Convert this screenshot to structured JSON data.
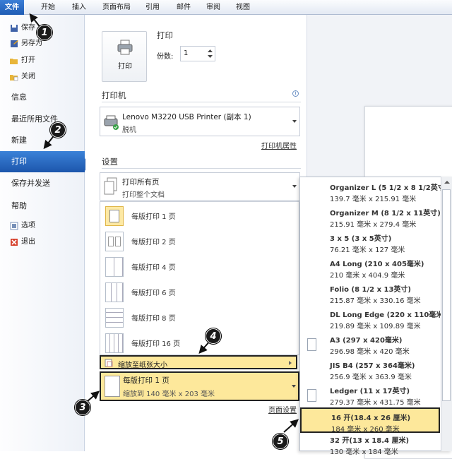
{
  "ribbon": {
    "tabs": [
      "文件",
      "开始",
      "插入",
      "页面布局",
      "引用",
      "邮件",
      "审阅",
      "视图"
    ]
  },
  "sidebar": {
    "save": "保存",
    "save_as": "另存为",
    "open": "打开",
    "close": "关闭",
    "info": "信息",
    "recent": "最近所用文件",
    "new": "新建",
    "print": "打印",
    "save_send": "保存并发送",
    "help": "帮助",
    "options": "选项",
    "exit": "退出"
  },
  "print": {
    "title": "打印",
    "button_label": "打印",
    "copies_label": "份数:",
    "copies_value": "1"
  },
  "printer": {
    "header": "打印机",
    "name": "Lenovo M3220 USB Printer (副本 1)",
    "status": "脱机",
    "properties_link": "打印机属性"
  },
  "settings": {
    "header": "设置",
    "range_title": "打印所有页",
    "range_sub": "打印整个文档",
    "page_setup_link": "页面设置"
  },
  "pages_per_sheet": {
    "options": [
      "每版打印 1 页",
      "每版打印 2 页",
      "每版打印 4 页",
      "每版打印 6 页",
      "每版打印 8 页",
      "每版打印 16 页"
    ],
    "scale_label": "缩放至纸张大小",
    "current_title": "每版打印 1 页",
    "current_sub": "缩放到 140 毫米 x 203 毫米"
  },
  "paper_sizes": [
    {
      "name": "Organizer L (5 1/2 x 8 1/2英寸)",
      "dims": "139.7 毫米 x 215.91 毫米"
    },
    {
      "name": "Organizer M (8 1/2 x 11英寸)",
      "dims": "215.91 毫米 x 279.4 毫米"
    },
    {
      "name": "3 x 5 (3 x 5英寸)",
      "dims": "76.21 毫米 x 127 毫米"
    },
    {
      "name": "A4 Long (210 x 405毫米)",
      "dims": "210 毫米 x 404.9 毫米"
    },
    {
      "name": "Folio (8 1/2 x 13英寸)",
      "dims": "215.87 毫米 x 330.16 毫米"
    },
    {
      "name": "DL Long Edge (220 x 110毫米)",
      "dims": "219.89 毫米 x 109.89 毫米"
    },
    {
      "name": "A3 (297 x 420毫米)",
      "dims": "296.98 毫米 x 420 毫米"
    },
    {
      "name": "JIS B4 (257 x 364毫米)",
      "dims": "256.9 毫米 x 363.9 毫米"
    },
    {
      "name": "Ledger (11 x 17英寸)",
      "dims": "279.37 毫米 x 431.75 毫米"
    },
    {
      "name": "16 开(18.4 x 26 厘米)",
      "dims": "184 毫米 x 260 毫米"
    },
    {
      "name": "32 开(13 x 18.4 厘米)",
      "dims": "130 毫米 x 184 毫米"
    }
  ],
  "callouts": [
    "1",
    "2",
    "3",
    "4",
    "5"
  ]
}
